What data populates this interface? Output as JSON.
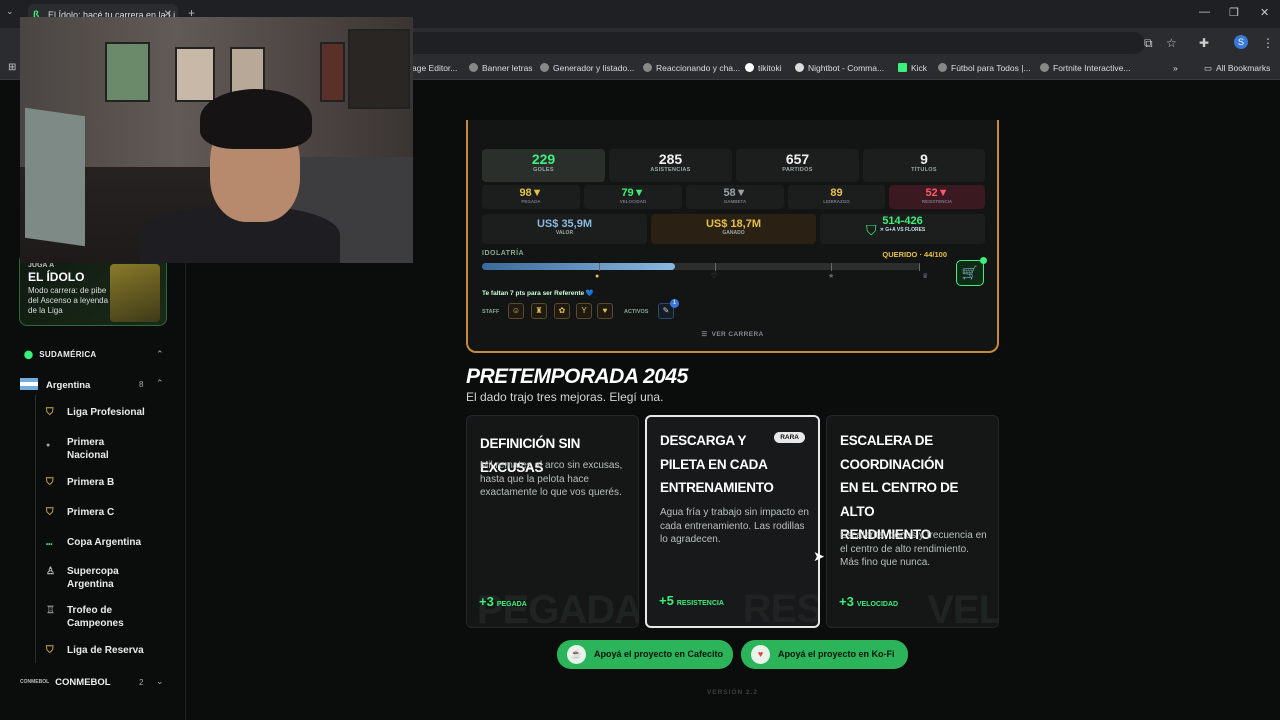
{
  "browser": {
    "tab_title": "El Ídolo: hacé tu carrera en la Li",
    "bookmarks": [
      {
        "label": "age Editor..."
      },
      {
        "label": "Banner letras"
      },
      {
        "label": "Generador y listado..."
      },
      {
        "label": "Reaccionando y cha..."
      },
      {
        "label": "tikitoki"
      },
      {
        "label": "Nightbot - Comma..."
      },
      {
        "label": "Kick"
      },
      {
        "label": "Fútbol para Todos |..."
      },
      {
        "label": "Fortnite Interactive..."
      }
    ],
    "all_bookmarks": "All Bookmarks",
    "profile_initial": "S"
  },
  "sidebar": {
    "promo": {
      "kicker": "JUGÁ A",
      "title": "EL ÍDOLO",
      "desc": "Modo carrera: de pibe del Ascenso a leyenda de la Liga"
    },
    "region": "SUDAMÉRICA",
    "country": {
      "name": "Argentina",
      "count": "8"
    },
    "leagues": [
      {
        "label": "Liga Profesional"
      },
      {
        "label": "Primera Nacional"
      },
      {
        "label": "Primera B"
      },
      {
        "label": "Primera C"
      },
      {
        "label": "Copa Argentina"
      },
      {
        "label": "Supercopa Argentina"
      },
      {
        "label": "Trofeo de Campeones"
      },
      {
        "label": "Liga de Reserva"
      }
    ],
    "conmebol": {
      "logo": "CONMEBOL",
      "name": "CONMEBOL",
      "count": "2"
    }
  },
  "career": {
    "stats": [
      {
        "value": "229",
        "label": "GOLES",
        "color": "#3df07a"
      },
      {
        "value": "285",
        "label": "ASISTENCIAS",
        "color": "#f0f0f0"
      },
      {
        "value": "657",
        "label": "PARTIDOS",
        "color": "#f0f0f0"
      },
      {
        "value": "9",
        "label": "TÍTULOS",
        "color": "#f0f0f0"
      }
    ],
    "attributes": [
      {
        "value": "98▼",
        "label": "PEGADA",
        "color": "#e7c04b"
      },
      {
        "value": "79▼",
        "label": "VELOCIDAD",
        "color": "#3df07a"
      },
      {
        "value": "58▼",
        "label": "GAMBETA",
        "color": "#9aa3a8"
      },
      {
        "value": "89",
        "label": "LIDERAZGO",
        "color": "#e7c04b"
      },
      {
        "value": "52▼",
        "label": "RESISTENCIA",
        "color": "#ff5a6a"
      }
    ],
    "valor": {
      "value": "US$ 35,9M",
      "label": "VALOR"
    },
    "ganado": {
      "value": "US$ 18,7M",
      "label": "GANADO"
    },
    "rival": {
      "value": "514-426",
      "label": "✕ G+A VS FLORES"
    },
    "idolatria": {
      "label": "IDOLATRÍA",
      "status": "QUERIDO · 44/100",
      "progress": 0.44
    },
    "faltan": "Te faltan 7 pts para ser Referente 💙",
    "staff_label": "STAFF",
    "staff_icons": [
      "person-icon",
      "trainer-icon",
      "brain-icon",
      "trophy-icon",
      "heart-icon"
    ],
    "activos_label": "ACTIVOS",
    "activos_count": "1",
    "ver_carrera": "VER CARRERA"
  },
  "pretemporada": {
    "title": "PRETEMPORADA 2045",
    "subtitle": "El dado trajo tres mejoras. Elegí una.",
    "options": [
      {
        "title": "DEFINICIÓN SIN EXCUSAS",
        "desc": "Mil remates al arco sin excusas, hasta que la pelota hace exactamente lo que vos querés.",
        "bonus": "+3",
        "stat": "PEGADA",
        "watermark": "PEGADA"
      },
      {
        "title": "DESCARGA Y PILETA EN CADA ENTRENAMIENTO",
        "desc": "Agua fría y trabajo sin impacto en cada entrenamiento. Las rodillas lo agradecen.",
        "bonus": "+5",
        "stat": "RESISTENCIA",
        "watermark": "RES",
        "badge": "RARA"
      },
      {
        "title": "ESCALERA DE COORDINACIÓN EN EL CENTRO DE ALTO RENDIMIENTO",
        "desc": "Escalerita, conos y frecuencia en el centro de alto rendimiento. Más fino que nunca.",
        "bonus": "+3",
        "stat": "VELOCIDAD",
        "watermark": "VEL"
      }
    ]
  },
  "support": {
    "cafecito": "Apoyá el proyecto en Cafecito",
    "kofi": "Apoyá el proyecto en Ko-Fi"
  },
  "version": "VERSIÓN 2.2"
}
